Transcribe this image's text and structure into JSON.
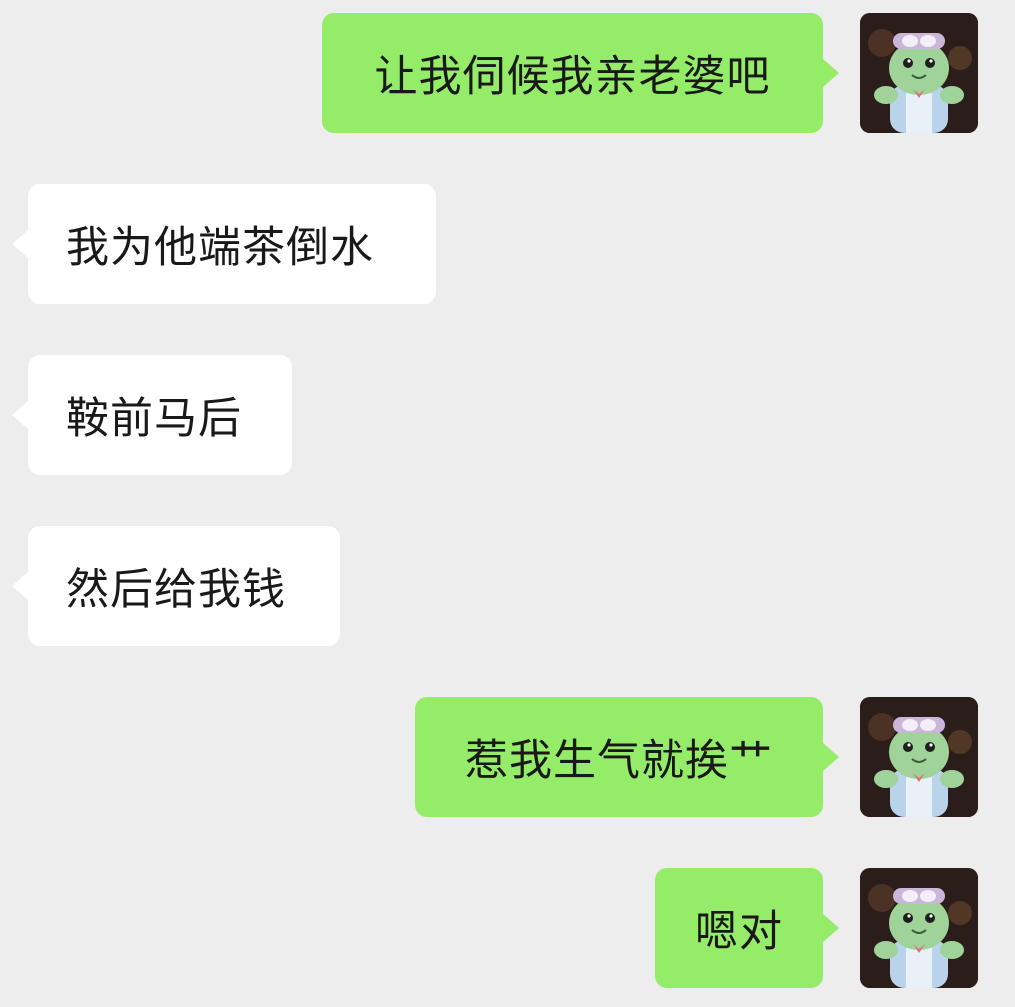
{
  "messages": [
    {
      "side": "out",
      "text": "让我伺候我亲老婆吧"
    },
    {
      "side": "in",
      "text": "我为他端茶倒水"
    },
    {
      "side": "in",
      "text": "鞍前马后"
    },
    {
      "side": "in",
      "text": "然后给我钱"
    },
    {
      "side": "out",
      "text": "惹我生气就挨艹"
    },
    {
      "side": "out",
      "text": "嗯对"
    }
  ],
  "colors": {
    "background": "#ededed",
    "outgoing_bubble": "#95ec69",
    "incoming_bubble": "#ffffff",
    "text": "#191919"
  },
  "avatar": {
    "icon": "mascot-avatar-icon",
    "description_for_icon_only": "green turtle mascot with goggles"
  }
}
